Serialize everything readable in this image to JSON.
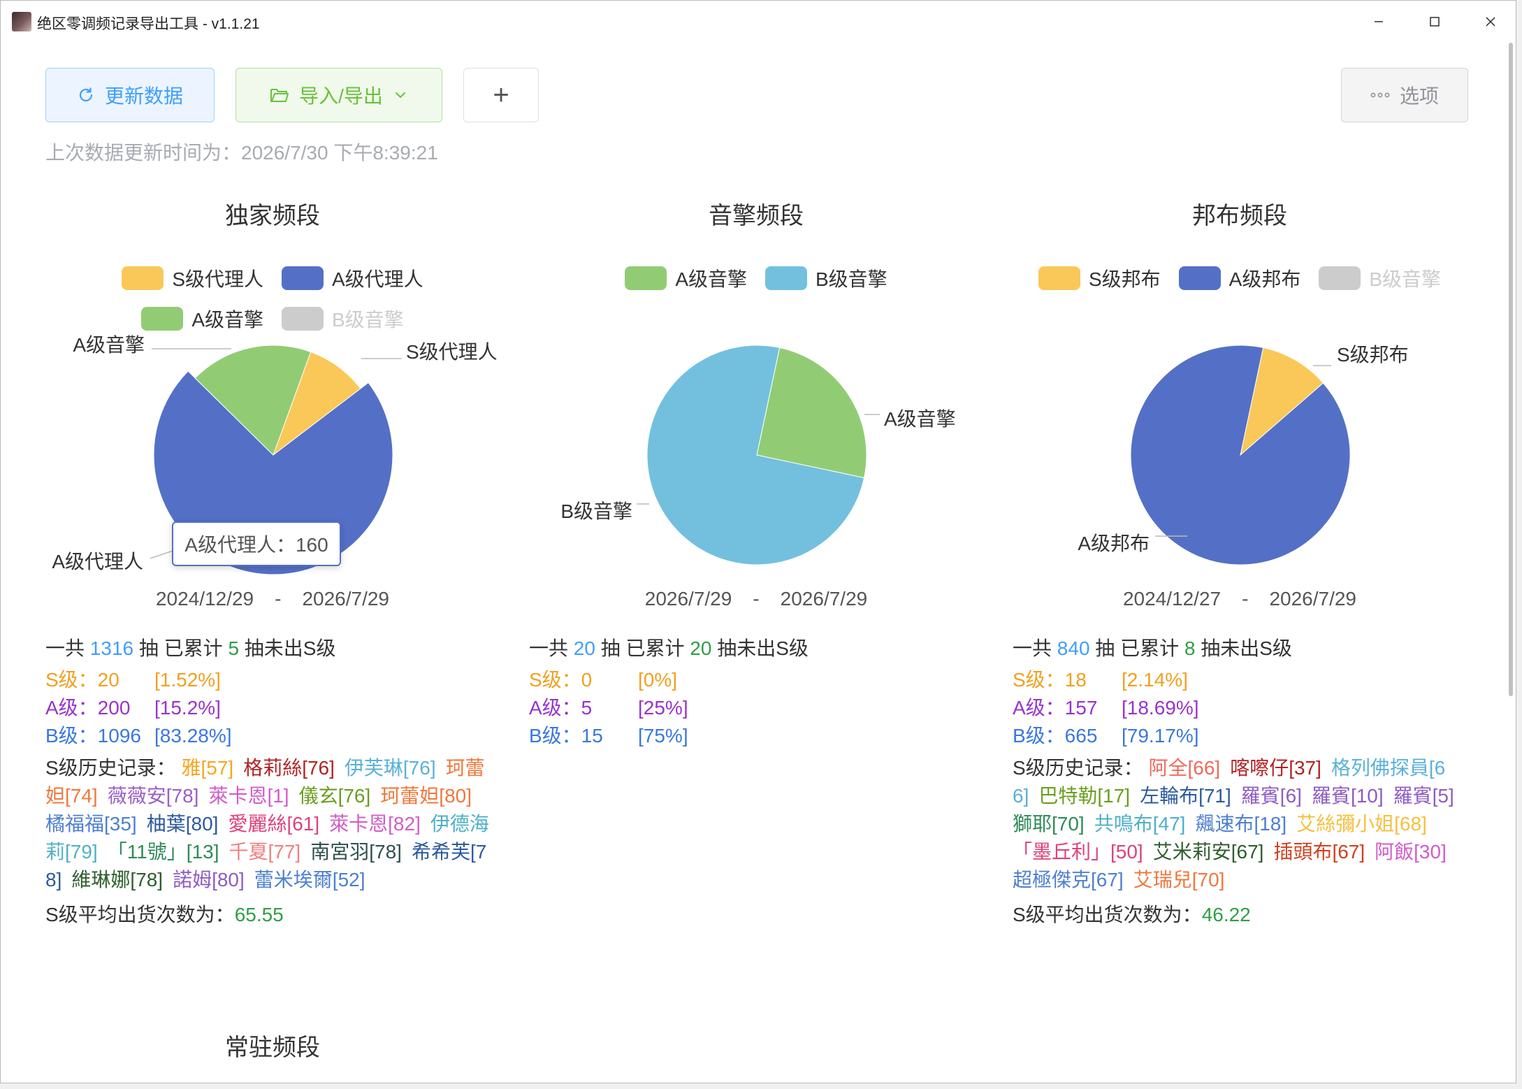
{
  "window": {
    "title": "绝区零调频记录导出工具 - v1.1.21"
  },
  "toolbar": {
    "refresh_label": "更新数据",
    "import_label": "导入/导出",
    "add_label": "+",
    "options_label": "选项",
    "last_update": "上次数据更新时间为：2026/7/30 下午8:39:21"
  },
  "colors": {
    "s": "#fac858",
    "a": "#5470c6",
    "a_engine": "#91cc75",
    "b": "#73c0de",
    "off": "#cccccc"
  },
  "sections": [
    {
      "title": "独家频段",
      "legend": [
        [
          "S级代理人",
          "A级代理人"
        ],
        [
          "A级音擎",
          "B级音擎"
        ]
      ],
      "date_from": "2024/12/29",
      "date_to": "2026/7/29",
      "date_sep": "-",
      "summary": {
        "p1": "一共",
        "total": "1316",
        "p2": "抽 已累计",
        "pity": "5",
        "p3": "抽未出S级"
      },
      "grades": {
        "s": {
          "label": "S级：20",
          "pct": "[1.52%]"
        },
        "a": {
          "label": "A级：200",
          "pct": "[15.2%]"
        },
        "b": {
          "label": "B级：1096",
          "pct": "[83.28%]"
        }
      },
      "history_label": "S级历史记录：",
      "history": [
        {
          "text": "雅[57]",
          "color": "#f5a623"
        },
        {
          "text": "格莉絲[76]",
          "color": "#b22222"
        },
        {
          "text": "伊芙琳[76]",
          "color": "#5ab1d8"
        },
        {
          "text": "珂蕾妲[74]",
          "color": "#f0783c"
        },
        {
          "text": "薇薇安[78]",
          "color": "#9a5fc7"
        },
        {
          "text": "萊卡恩[1]",
          "color": "#d15cc9"
        },
        {
          "text": "儀玄[76]",
          "color": "#6a9e1f"
        },
        {
          "text": "珂蕾妲[80]",
          "color": "#f0783c"
        },
        {
          "text": "橘福福[35]",
          "color": "#4e7fd0"
        },
        {
          "text": "柚葉[80]",
          "color": "#2c5aa0"
        },
        {
          "text": "愛麗絲[61]",
          "color": "#e0407a"
        },
        {
          "text": "萊卡恩[82]",
          "color": "#d15cc9"
        },
        {
          "text": "伊德海莉[79]",
          "color": "#4fb0c6"
        },
        {
          "text": "「11號」[13]",
          "color": "#2e8b57"
        },
        {
          "text": "千夏[77]",
          "color": "#f08080"
        },
        {
          "text": "南宮羽[78]",
          "color": "#2f4f4f"
        },
        {
          "text": "希希芙[78]",
          "color": "#2c5aa0"
        },
        {
          "text": "維琳娜[78]",
          "color": "#2e5e2e"
        },
        {
          "text": "諾姆[80]",
          "color": "#8e5cc2"
        },
        {
          "text": "蕾米埃爾[52]",
          "color": "#4e7fd0"
        }
      ],
      "avg_label": "S级平均出货次数为：",
      "avg": "65.55",
      "pie": {
        "values": [
          {
            "key": "s",
            "name": "S级代理人",
            "value": 20
          },
          {
            "key": "a",
            "name": "A级代理人",
            "value": 160
          },
          {
            "key": "a_engine",
            "name": "A级音擎",
            "value": 40
          }
        ],
        "labels": [
          "S级代理人",
          "A级音擎",
          "A级代理人"
        ],
        "emphasis_key": "a"
      },
      "tooltip": "A级代理人：160"
    },
    {
      "title": "音擎频段",
      "legend": [
        [
          "A级音擎",
          "B级音擎"
        ]
      ],
      "date_from": "2026/7/29",
      "date_to": "2026/7/29",
      "date_sep": "-",
      "summary": {
        "p1": "一共",
        "total": "20",
        "p2": "抽 已累计",
        "pity": "20",
        "p3": "抽未出S级"
      },
      "grades": {
        "s": {
          "label": "S级：0",
          "pct": "[0%]"
        },
        "a": {
          "label": "A级：5",
          "pct": "[25%]"
        },
        "b": {
          "label": "B级：15",
          "pct": "[75%]"
        }
      },
      "pie": {
        "values": [
          {
            "key": "a_engine",
            "name": "A级音擎",
            "value": 5
          },
          {
            "key": "b",
            "name": "B级音擎",
            "value": 15
          }
        ],
        "labels": [
          "A级音擎",
          "B级音擎"
        ]
      }
    },
    {
      "title": "邦布频段",
      "legend": [
        [
          "S级邦布",
          "A级邦布",
          "B级音擎"
        ]
      ],
      "date_from": "2024/12/27",
      "date_to": "2026/7/29",
      "date_sep": "-",
      "summary": {
        "p1": "一共",
        "total": "840",
        "p2": "抽 已累计",
        "pity": "8",
        "p3": "抽未出S级"
      },
      "grades": {
        "s": {
          "label": "S级：18",
          "pct": "[2.14%]"
        },
        "a": {
          "label": "A级：157",
          "pct": "[18.69%]"
        },
        "b": {
          "label": "B级：665",
          "pct": "[79.17%]"
        }
      },
      "history_label": "S级历史记录：",
      "history": [
        {
          "text": "阿全[66]",
          "color": "#f06a5a"
        },
        {
          "text": "喀嚓仔[37]",
          "color": "#b22222"
        },
        {
          "text": "格列佛探員[66]",
          "color": "#5ab1d8"
        },
        {
          "text": "巴特勒[17]",
          "color": "#6a9e1f"
        },
        {
          "text": "左輪布[71]",
          "color": "#2c5aa0"
        },
        {
          "text": "羅賓[6]",
          "color": "#8e5cc2"
        },
        {
          "text": "羅賓[10]",
          "color": "#8e5cc2"
        },
        {
          "text": "羅賓[5]",
          "color": "#8e5cc2"
        },
        {
          "text": "獅耶[70]",
          "color": "#2e8b57"
        },
        {
          "text": "共鳴布[47]",
          "color": "#4fb0c6"
        },
        {
          "text": "飆速布[18]",
          "color": "#4e7fd0"
        },
        {
          "text": "艾絲彌小姐[68]",
          "color": "#f5c040"
        },
        {
          "text": "「墨丘利」[50]",
          "color": "#e0407a"
        },
        {
          "text": "艾米莉安[67]",
          "color": "#2e5e2e"
        },
        {
          "text": "插頭布[67]",
          "color": "#d04020"
        },
        {
          "text": "阿飯[30]",
          "color": "#d15cc9"
        },
        {
          "text": "超極傑克[67]",
          "color": "#4e7fd0"
        },
        {
          "text": "艾瑞兒[70]",
          "color": "#f0783c"
        }
      ],
      "avg_label": "S级平均出货次数为：",
      "avg": "46.22",
      "pie": {
        "values": [
          {
            "key": "s",
            "name": "S级邦布",
            "value": 18
          },
          {
            "key": "a",
            "name": "A级邦布",
            "value": 157
          }
        ],
        "labels": [
          "S级邦布",
          "A级邦布"
        ]
      }
    },
    {
      "title": "常驻频段"
    }
  ],
  "chart_data": [
    {
      "type": "pie",
      "title": "独家频段",
      "categories": [
        "S级代理人",
        "A级代理人",
        "A级音擎",
        "B级音擎"
      ],
      "values": [
        20,
        160,
        40,
        0
      ],
      "legend_disabled": [
        "B级音擎"
      ],
      "legend_placement": "top"
    },
    {
      "type": "pie",
      "title": "音擎频段",
      "categories": [
        "A级音擎",
        "B级音擎"
      ],
      "values": [
        5,
        15
      ],
      "legend_placement": "top"
    },
    {
      "type": "pie",
      "title": "邦布频段",
      "categories": [
        "S级邦布",
        "A级邦布",
        "B级音擎"
      ],
      "values": [
        18,
        157,
        0
      ],
      "legend_disabled": [
        "B级音擎"
      ],
      "legend_placement": "top"
    }
  ]
}
